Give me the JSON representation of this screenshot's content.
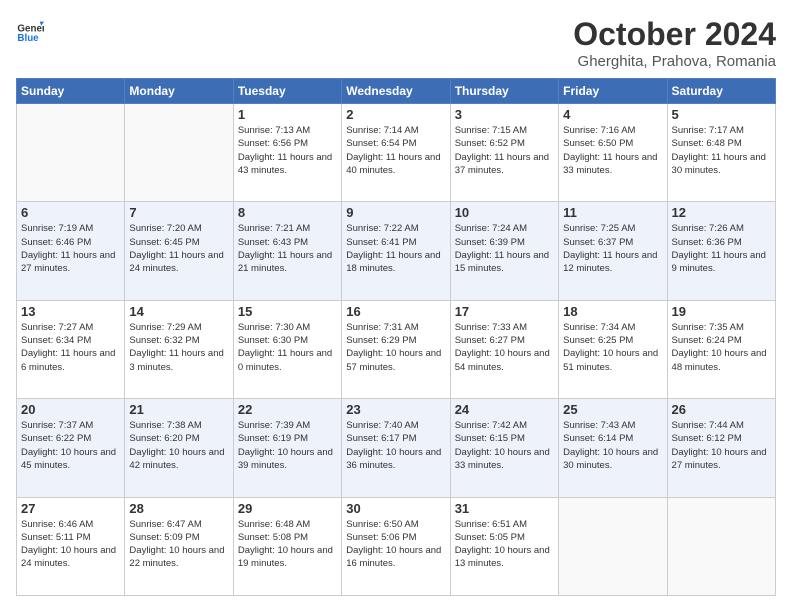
{
  "header": {
    "logo_general": "General",
    "logo_blue": "Blue",
    "month_title": "October 2024",
    "subtitle": "Gherghita, Prahova, Romania"
  },
  "weekdays": [
    "Sunday",
    "Monday",
    "Tuesday",
    "Wednesday",
    "Thursday",
    "Friday",
    "Saturday"
  ],
  "weeks": [
    [
      {
        "day": "",
        "sunrise": "",
        "sunset": "",
        "daylight": ""
      },
      {
        "day": "",
        "sunrise": "",
        "sunset": "",
        "daylight": ""
      },
      {
        "day": "1",
        "sunrise": "Sunrise: 7:13 AM",
        "sunset": "Sunset: 6:56 PM",
        "daylight": "Daylight: 11 hours and 43 minutes."
      },
      {
        "day": "2",
        "sunrise": "Sunrise: 7:14 AM",
        "sunset": "Sunset: 6:54 PM",
        "daylight": "Daylight: 11 hours and 40 minutes."
      },
      {
        "day": "3",
        "sunrise": "Sunrise: 7:15 AM",
        "sunset": "Sunset: 6:52 PM",
        "daylight": "Daylight: 11 hours and 37 minutes."
      },
      {
        "day": "4",
        "sunrise": "Sunrise: 7:16 AM",
        "sunset": "Sunset: 6:50 PM",
        "daylight": "Daylight: 11 hours and 33 minutes."
      },
      {
        "day": "5",
        "sunrise": "Sunrise: 7:17 AM",
        "sunset": "Sunset: 6:48 PM",
        "daylight": "Daylight: 11 hours and 30 minutes."
      }
    ],
    [
      {
        "day": "6",
        "sunrise": "Sunrise: 7:19 AM",
        "sunset": "Sunset: 6:46 PM",
        "daylight": "Daylight: 11 hours and 27 minutes."
      },
      {
        "day": "7",
        "sunrise": "Sunrise: 7:20 AM",
        "sunset": "Sunset: 6:45 PM",
        "daylight": "Daylight: 11 hours and 24 minutes."
      },
      {
        "day": "8",
        "sunrise": "Sunrise: 7:21 AM",
        "sunset": "Sunset: 6:43 PM",
        "daylight": "Daylight: 11 hours and 21 minutes."
      },
      {
        "day": "9",
        "sunrise": "Sunrise: 7:22 AM",
        "sunset": "Sunset: 6:41 PM",
        "daylight": "Daylight: 11 hours and 18 minutes."
      },
      {
        "day": "10",
        "sunrise": "Sunrise: 7:24 AM",
        "sunset": "Sunset: 6:39 PM",
        "daylight": "Daylight: 11 hours and 15 minutes."
      },
      {
        "day": "11",
        "sunrise": "Sunrise: 7:25 AM",
        "sunset": "Sunset: 6:37 PM",
        "daylight": "Daylight: 11 hours and 12 minutes."
      },
      {
        "day": "12",
        "sunrise": "Sunrise: 7:26 AM",
        "sunset": "Sunset: 6:36 PM",
        "daylight": "Daylight: 11 hours and 9 minutes."
      }
    ],
    [
      {
        "day": "13",
        "sunrise": "Sunrise: 7:27 AM",
        "sunset": "Sunset: 6:34 PM",
        "daylight": "Daylight: 11 hours and 6 minutes."
      },
      {
        "day": "14",
        "sunrise": "Sunrise: 7:29 AM",
        "sunset": "Sunset: 6:32 PM",
        "daylight": "Daylight: 11 hours and 3 minutes."
      },
      {
        "day": "15",
        "sunrise": "Sunrise: 7:30 AM",
        "sunset": "Sunset: 6:30 PM",
        "daylight": "Daylight: 11 hours and 0 minutes."
      },
      {
        "day": "16",
        "sunrise": "Sunrise: 7:31 AM",
        "sunset": "Sunset: 6:29 PM",
        "daylight": "Daylight: 10 hours and 57 minutes."
      },
      {
        "day": "17",
        "sunrise": "Sunrise: 7:33 AM",
        "sunset": "Sunset: 6:27 PM",
        "daylight": "Daylight: 10 hours and 54 minutes."
      },
      {
        "day": "18",
        "sunrise": "Sunrise: 7:34 AM",
        "sunset": "Sunset: 6:25 PM",
        "daylight": "Daylight: 10 hours and 51 minutes."
      },
      {
        "day": "19",
        "sunrise": "Sunrise: 7:35 AM",
        "sunset": "Sunset: 6:24 PM",
        "daylight": "Daylight: 10 hours and 48 minutes."
      }
    ],
    [
      {
        "day": "20",
        "sunrise": "Sunrise: 7:37 AM",
        "sunset": "Sunset: 6:22 PM",
        "daylight": "Daylight: 10 hours and 45 minutes."
      },
      {
        "day": "21",
        "sunrise": "Sunrise: 7:38 AM",
        "sunset": "Sunset: 6:20 PM",
        "daylight": "Daylight: 10 hours and 42 minutes."
      },
      {
        "day": "22",
        "sunrise": "Sunrise: 7:39 AM",
        "sunset": "Sunset: 6:19 PM",
        "daylight": "Daylight: 10 hours and 39 minutes."
      },
      {
        "day": "23",
        "sunrise": "Sunrise: 7:40 AM",
        "sunset": "Sunset: 6:17 PM",
        "daylight": "Daylight: 10 hours and 36 minutes."
      },
      {
        "day": "24",
        "sunrise": "Sunrise: 7:42 AM",
        "sunset": "Sunset: 6:15 PM",
        "daylight": "Daylight: 10 hours and 33 minutes."
      },
      {
        "day": "25",
        "sunrise": "Sunrise: 7:43 AM",
        "sunset": "Sunset: 6:14 PM",
        "daylight": "Daylight: 10 hours and 30 minutes."
      },
      {
        "day": "26",
        "sunrise": "Sunrise: 7:44 AM",
        "sunset": "Sunset: 6:12 PM",
        "daylight": "Daylight: 10 hours and 27 minutes."
      }
    ],
    [
      {
        "day": "27",
        "sunrise": "Sunrise: 6:46 AM",
        "sunset": "Sunset: 5:11 PM",
        "daylight": "Daylight: 10 hours and 24 minutes."
      },
      {
        "day": "28",
        "sunrise": "Sunrise: 6:47 AM",
        "sunset": "Sunset: 5:09 PM",
        "daylight": "Daylight: 10 hours and 22 minutes."
      },
      {
        "day": "29",
        "sunrise": "Sunrise: 6:48 AM",
        "sunset": "Sunset: 5:08 PM",
        "daylight": "Daylight: 10 hours and 19 minutes."
      },
      {
        "day": "30",
        "sunrise": "Sunrise: 6:50 AM",
        "sunset": "Sunset: 5:06 PM",
        "daylight": "Daylight: 10 hours and 16 minutes."
      },
      {
        "day": "31",
        "sunrise": "Sunrise: 6:51 AM",
        "sunset": "Sunset: 5:05 PM",
        "daylight": "Daylight: 10 hours and 13 minutes."
      },
      {
        "day": "",
        "sunrise": "",
        "sunset": "",
        "daylight": ""
      },
      {
        "day": "",
        "sunrise": "",
        "sunset": "",
        "daylight": ""
      }
    ]
  ]
}
